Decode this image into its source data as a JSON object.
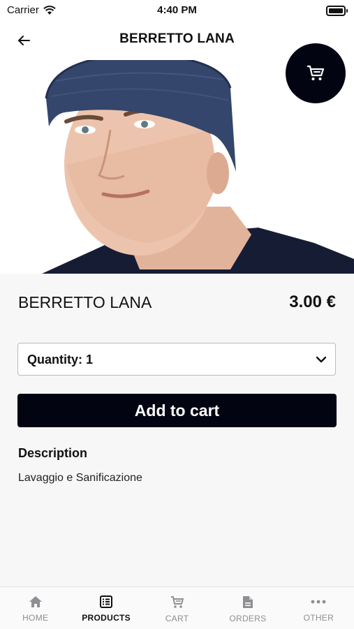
{
  "status": {
    "carrier": "Carrier",
    "time": "4:40 PM"
  },
  "header": {
    "title": "BERRETTO LANA"
  },
  "product": {
    "name": "BERRETTO LANA",
    "price": "3.00 €",
    "carousel": {
      "slides": 1,
      "current": 1
    }
  },
  "quantity": {
    "label": "Quantity: 1"
  },
  "add_to_cart": {
    "label": "Add to cart"
  },
  "description": {
    "heading": "Description",
    "text": "Lavaggio e Sanificazione"
  },
  "tabs": [
    {
      "label": "HOME",
      "icon": "home-icon",
      "active": false
    },
    {
      "label": "PRODUCTS",
      "icon": "products-list-icon",
      "active": true
    },
    {
      "label": "CART",
      "icon": "cart-icon",
      "active": false
    },
    {
      "label": "ORDERS",
      "icon": "orders-document-icon",
      "active": false
    },
    {
      "label": "OTHER",
      "icon": "more-dots-icon",
      "active": false
    }
  ],
  "colors": {
    "primary": "#030412",
    "background": "#f7f7f7",
    "inactive_tab": "#8e8e93"
  }
}
